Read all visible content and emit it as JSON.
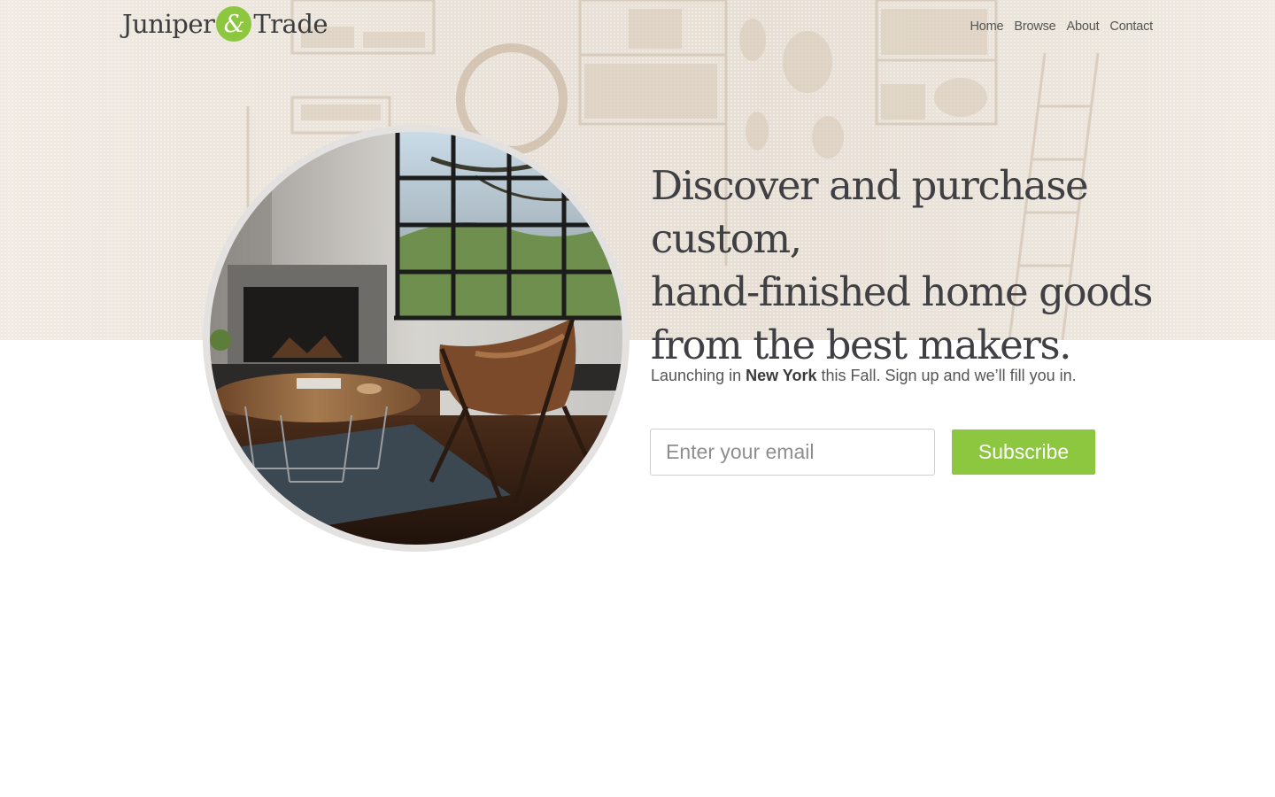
{
  "brand": {
    "name_left": "Juniper",
    "ampersand": "&",
    "name_right": "Trade",
    "accent_color": "#8dc63f"
  },
  "nav": {
    "items": [
      {
        "label": "Home"
      },
      {
        "label": "Browse"
      },
      {
        "label": "About"
      },
      {
        "label": "Contact"
      }
    ]
  },
  "hero": {
    "headline_line1": "Discover and purchase custom,",
    "headline_line2": "hand-finished home goods",
    "headline_line3": "from the best makers.",
    "tagline_prefix": "Launching in ",
    "tagline_city": "New York",
    "tagline_suffix": " this Fall. Sign up and we’ll fill you in.",
    "photo_alt": "living room with leather sling chair, round coffee table and fireplace",
    "background_color": "#efe9e1"
  },
  "signup": {
    "email_placeholder": "Enter your email",
    "email_value": "",
    "button_label": "Subscribe"
  }
}
